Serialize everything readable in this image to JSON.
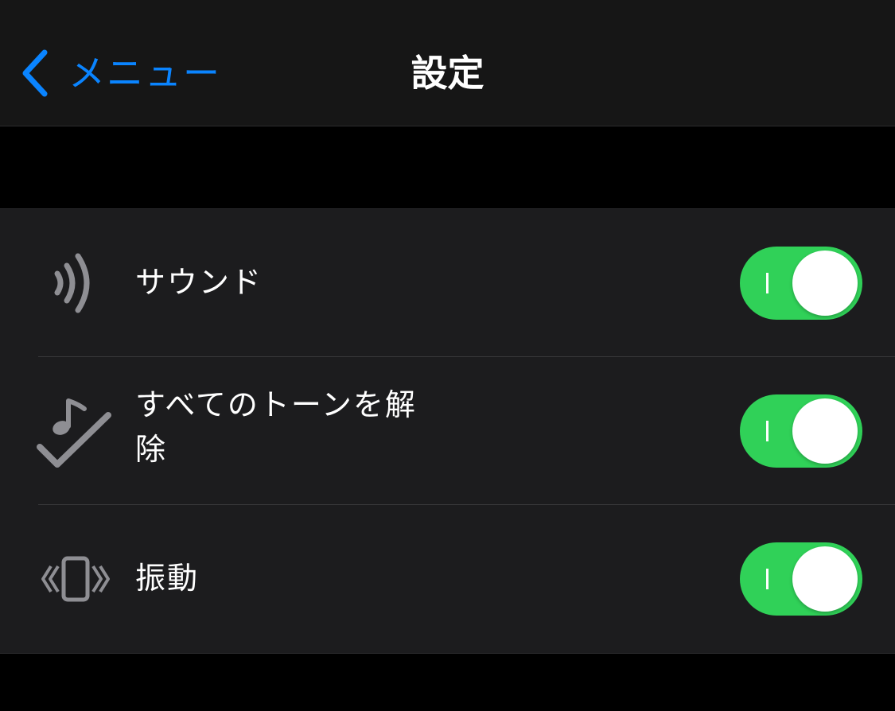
{
  "navbar": {
    "back_label": "メニュー",
    "title": "設定"
  },
  "settings": [
    {
      "label": "サウンド",
      "icon": "sound-waves-icon",
      "enabled": true
    },
    {
      "label": "すべてのトーンを解除",
      "icon": "music-note-checkmark-icon",
      "enabled": true
    },
    {
      "label": "振動",
      "icon": "vibration-icon",
      "enabled": true
    }
  ],
  "colors": {
    "accent": "#0a84ff",
    "toggle_on": "#30d158",
    "background": "#000000",
    "cell_background": "#1c1c1e",
    "icon_gray": "#8e8e93"
  }
}
